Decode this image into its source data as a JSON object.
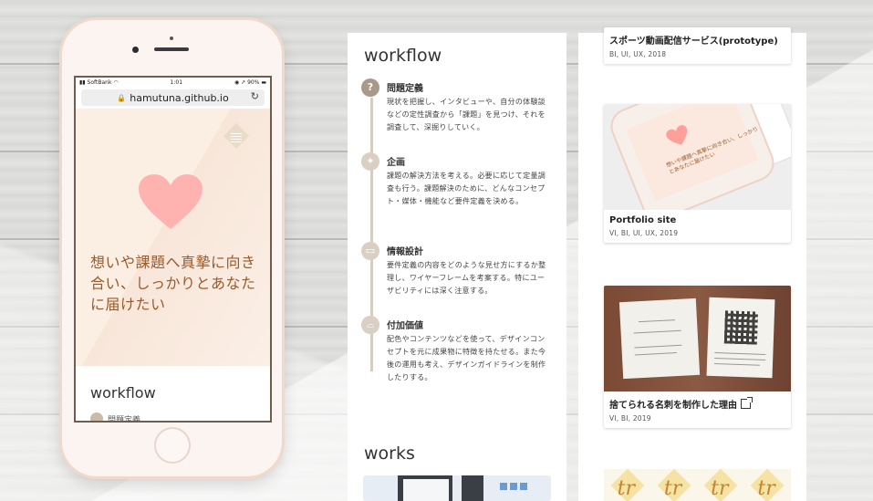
{
  "phone": {
    "status_carrier": "SoftBank",
    "status_time": "1:01",
    "status_battery": "90%",
    "url": "hamutuna.github.io",
    "tagline": "想いや課題へ真摯に向き合い、しっかりとあなたに届けたい",
    "section_title": "workflow",
    "peek_text": "問題定義"
  },
  "workflow": {
    "title": "workflow",
    "steps": [
      {
        "icon": "question-icon",
        "title": "問題定義",
        "desc": "現状を把握し、インタビューや、自分の体験談などの定性調査から「課題」を見つけ、それを調査して、深掘りしていく。"
      },
      {
        "icon": "lightbulb-icon",
        "title": "企画",
        "desc": "課題の解決方法を考える。必要に応じて定量調査も行う。課題解決のために、どんなコンセプト・媒体・機能など要件定義を決める。"
      },
      {
        "icon": "browser-window-icon",
        "title": "情報設計",
        "desc": "要件定義の内容をどのような見せ方にするか整理し、ワイヤーフレームを考案する。特にユーザビリティには深く注意する。"
      },
      {
        "icon": "cloche-icon",
        "title": "付加価値",
        "desc": "配色やコンテンツなどを使って、デザインコンセプトを元に成果物に特徴を持たせる。また今後の運用も考え、デザインガイドラインを制作したりする。"
      }
    ],
    "works_title": "works"
  },
  "works": {
    "cards": [
      {
        "title": "スポーツ動画配信サービス(prototype)",
        "tags": "BI,  UI,  UX,  2018"
      },
      {
        "title": "Portfolio site",
        "tags": "VI, BI, UI, UX,  2019",
        "image_text": "想いや課題へ真摯に向き合い、しっかりとあなたに届けたい"
      },
      {
        "title": "捨てられる名刺を制作した理由",
        "tags": "VI, BI,  2019",
        "external": true
      }
    ],
    "pattern_glyph": "tr"
  },
  "colors": {
    "accent_brown": "#9b5a2a",
    "heart_pink": "#ffb3b0",
    "hero_bg": "#fbeee2",
    "timeline": "#d6cdc1"
  }
}
